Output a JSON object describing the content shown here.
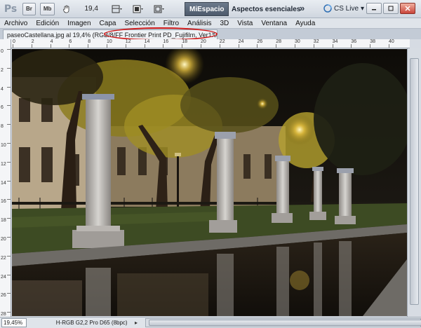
{
  "app": {
    "logo": "Ps",
    "toolbar_buttons": [
      "Br",
      "Mb"
    ],
    "zoom": "19,4",
    "workspace_active": "MiEspacio",
    "workspace_alt": "Aspectos esenciales",
    "more": "»",
    "cs_live": "CS Live",
    "cs_live_caret": "▾"
  },
  "menu": [
    "Archivo",
    "Edición",
    "Imagen",
    "Capa",
    "Selección",
    "Filtro",
    "Análisis",
    "3D",
    "Vista",
    "Ventana",
    "Ayuda"
  ],
  "document": {
    "tab_title": "paseoCastellana.jpg al 19,4% (RGB/8/FF Frontier Print PD_Fujifilm, Ver1.0)",
    "tab_close": "×"
  },
  "ruler_top": [
    "0",
    "2",
    "4",
    "6",
    "8",
    "10",
    "12",
    "14",
    "16",
    "18",
    "20",
    "22",
    "24",
    "26",
    "28",
    "30",
    "32",
    "34",
    "36",
    "38",
    "40"
  ],
  "ruler_left": [
    "0",
    "2",
    "4",
    "6",
    "8",
    "10",
    "12",
    "14",
    "16",
    "18",
    "20",
    "22",
    "24",
    "26",
    "28"
  ],
  "status": {
    "zoom": "19,45%",
    "profile": "H-RGB G2,2 Pro D65 (8bpc)",
    "arrow": "▸"
  },
  "colors": {
    "accent": "#4d5a6b",
    "highlight": "#d11a1a"
  },
  "icons": [
    "photoshop-logo",
    "bridge-button",
    "minibridge-button",
    "hand-tool-icon",
    "view-extras-icon",
    "arrange-documents-icon",
    "screen-mode-icon",
    "cs-live-icon",
    "minimize-icon",
    "restore-icon",
    "close-icon"
  ]
}
